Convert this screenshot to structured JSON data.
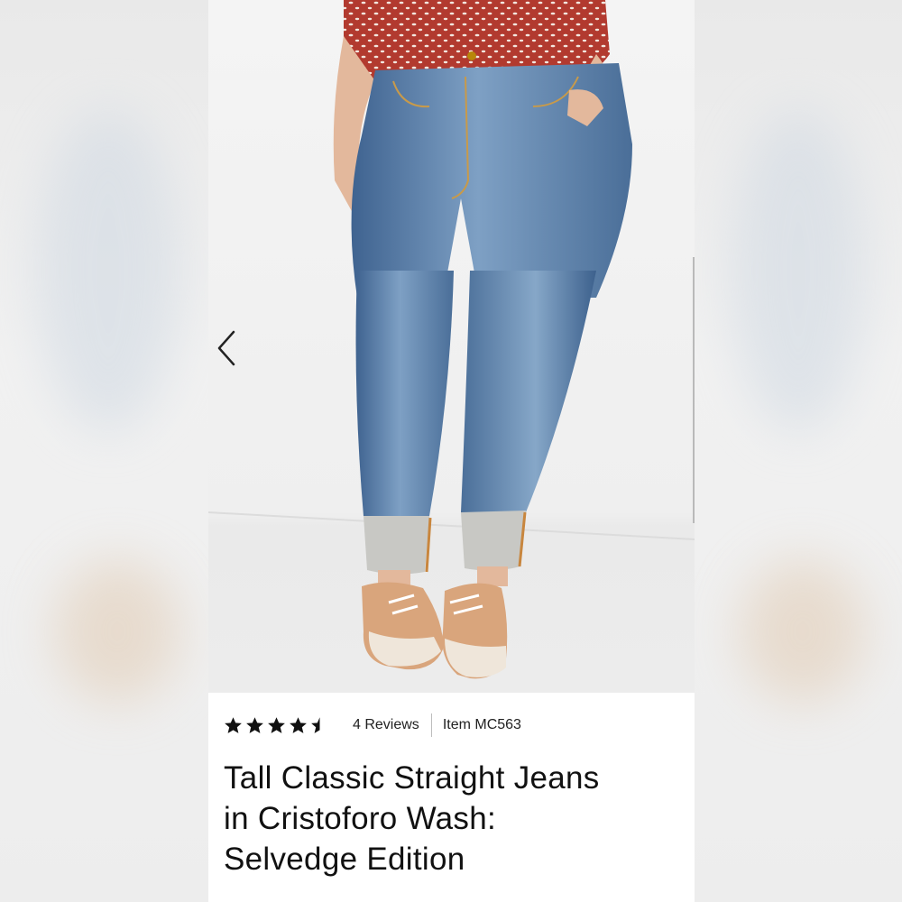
{
  "product": {
    "title_line1": "Tall Classic Straight Jeans",
    "title_line2": "in Cristoforo Wash:",
    "title_line3": "Selvedge Edition",
    "rating": 4.5,
    "rating_max": 5,
    "reviews_label": "4 Reviews",
    "item_label": "Item MC563"
  },
  "icons": {
    "prev": "chevron-left-icon",
    "star": "star-icon"
  },
  "colors": {
    "text": "#111111",
    "star": "#111111",
    "denim": "#5a7fa8",
    "blouse": "#b0352c"
  }
}
